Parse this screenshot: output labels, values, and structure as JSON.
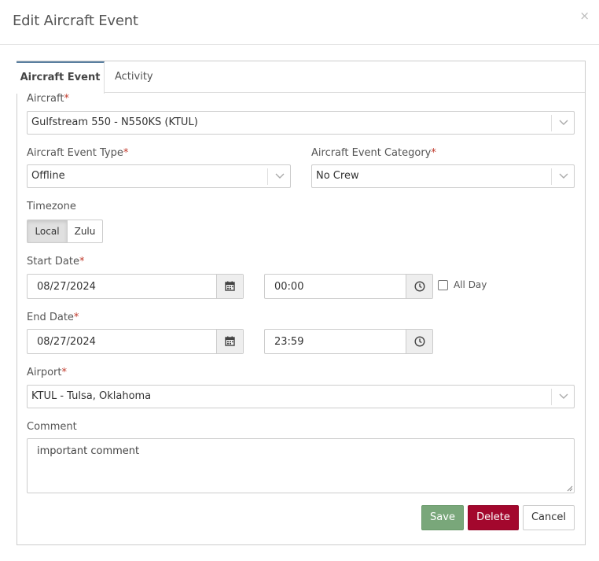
{
  "dialog": {
    "title": "Edit Aircraft Event",
    "close_symbol": "×"
  },
  "tabs": [
    {
      "label": "Aircraft Event",
      "active": true
    },
    {
      "label": "Activity",
      "active": false
    }
  ],
  "required_marker": "*",
  "fields": {
    "aircraft": {
      "label": "Aircraft",
      "value": "Gulfstream 550 - N550KS (KTUL)"
    },
    "event_type": {
      "label": "Aircraft Event Type",
      "value": "Offline"
    },
    "event_category": {
      "label": "Aircraft Event Category",
      "value": "No Crew"
    },
    "timezone": {
      "label": "Timezone",
      "options": [
        "Local",
        "Zulu"
      ],
      "selected": "Local"
    },
    "start": {
      "label": "Start Date",
      "date": "08/27/2024",
      "time": "00:00"
    },
    "all_day": {
      "label": "All Day",
      "checked": false
    },
    "end": {
      "label": "End Date",
      "date": "08/27/2024",
      "time": "23:59"
    },
    "airport": {
      "label": "Airport",
      "value": "KTUL - Tulsa, Oklahoma"
    },
    "comment": {
      "label": "Comment",
      "value": "important comment"
    }
  },
  "buttons": {
    "save": "Save",
    "delete": "Delete",
    "cancel": "Cancel"
  },
  "colors": {
    "save": "#79a77a",
    "delete": "#a3072d",
    "required": "#c0392b",
    "active_tab": "#5a7fa0"
  }
}
